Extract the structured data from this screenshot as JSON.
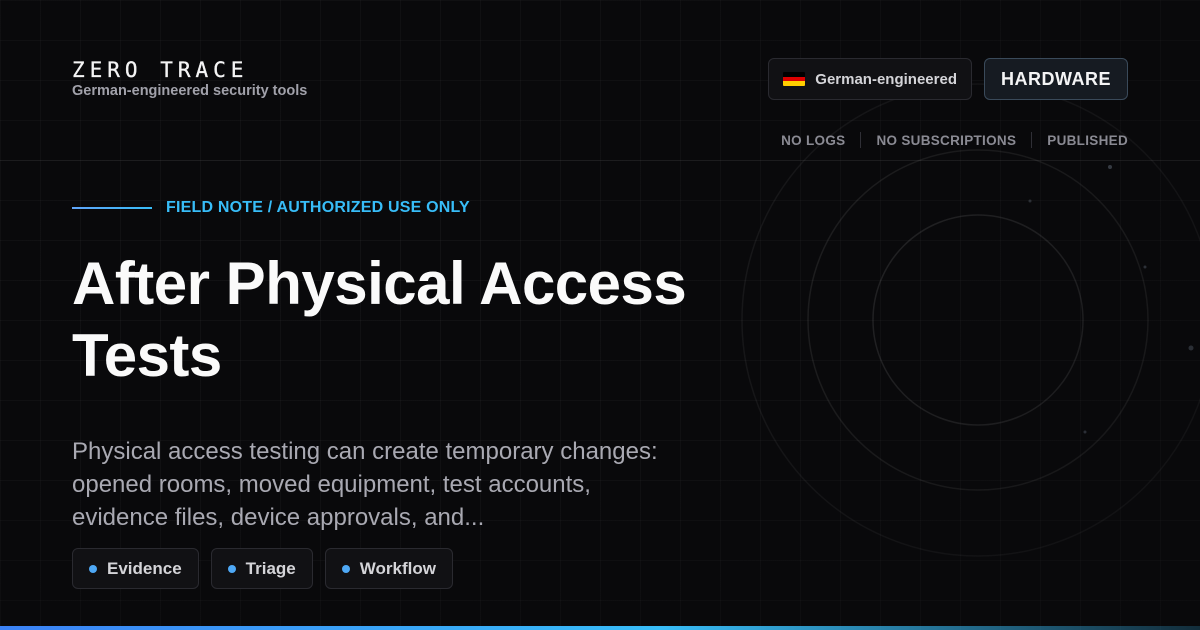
{
  "brand": {
    "logo": "ZERO TRACE",
    "tagline": "German-engineered security tools"
  },
  "header": {
    "origin_chip": "German-engineered",
    "origin_icon": "germany-flag-icon",
    "category_chip": "HARDWARE",
    "meta": [
      "NO LOGS",
      "NO SUBSCRIPTIONS",
      "PUBLISHED"
    ]
  },
  "article": {
    "eyebrow": "FIELD NOTE / AUTHORIZED USE ONLY",
    "title": "After Physical Access Tests",
    "description": "Physical access testing can create temporary changes: opened rooms, moved equipment, test accounts, evidence files, device approvals, and...",
    "tags": [
      "Evidence",
      "Triage",
      "Workflow"
    ]
  },
  "colors": {
    "background": "#09090b",
    "accent": "#38bdf8",
    "accent_blue": "#3b82f6",
    "tag_dot": "#4ea8f5",
    "flag": [
      "#000000",
      "#dd0000",
      "#ffce00"
    ]
  }
}
